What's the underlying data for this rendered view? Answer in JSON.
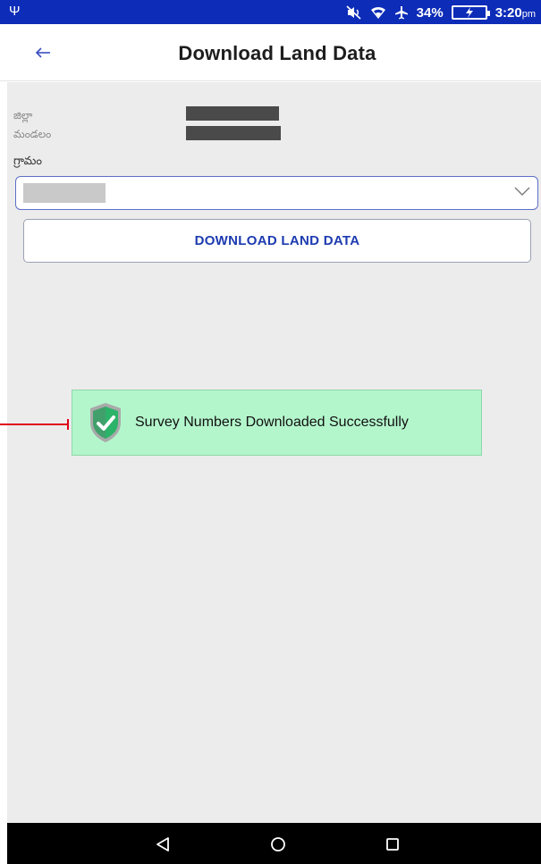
{
  "status_bar": {
    "usb_symbol": "Ψ",
    "battery_percent": "34%",
    "time": "3:20",
    "ampm": "pm",
    "icons": [
      "usb-icon",
      "mute-icon",
      "wifi-icon",
      "airplane-icon",
      "battery-charging-icon"
    ]
  },
  "header": {
    "title": "Download Land Data",
    "back_icon": "back-arrow-icon"
  },
  "form": {
    "district_label": "జిల్లా",
    "mandal_label": "మండలం",
    "village_label": "గ్రామం",
    "village_select_icon": "chevron-down-icon",
    "download_button": "DOWNLOAD LAND DATA"
  },
  "toast": {
    "message": "Survey Numbers Downloaded Successfully",
    "icon": "shield-check-icon"
  },
  "nav_bar": {
    "icons": [
      "nav-back-icon",
      "nav-home-icon",
      "nav-recents-icon"
    ]
  },
  "colors": {
    "status_bar": "#0d2cb8",
    "accent": "#1d3bb0",
    "toast_bg": "#b4f6cc",
    "shield_green": "#2bb36a",
    "annotation_red": "#e0001a"
  }
}
